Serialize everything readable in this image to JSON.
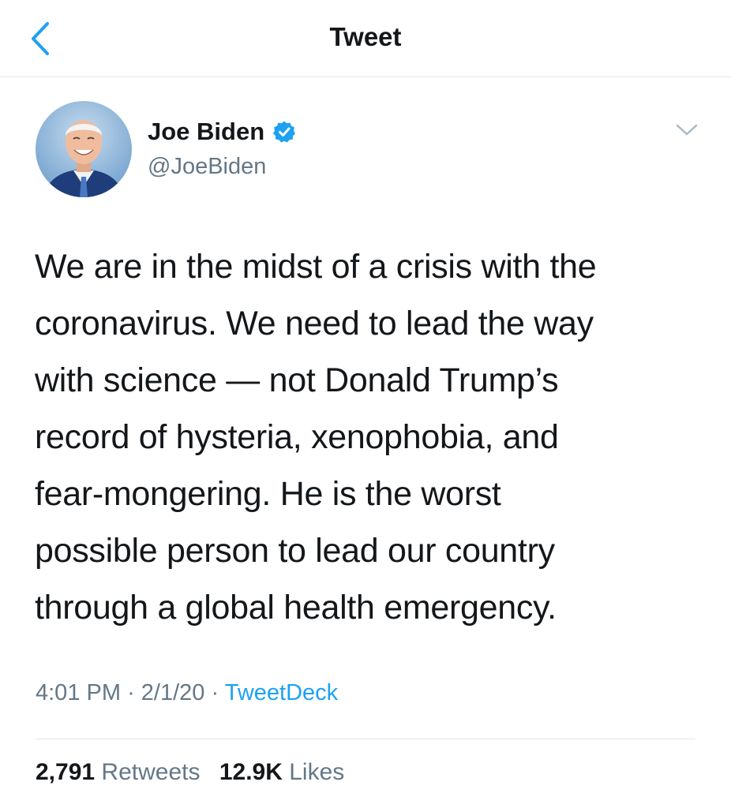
{
  "header": {
    "title": "Tweet",
    "back_icon": "chevron-left-icon"
  },
  "author": {
    "name": "Joe Biden",
    "handle": "@JoeBiden",
    "verified": true,
    "verified_icon": "verified-badge-icon"
  },
  "tweet": {
    "lines": [
      "We are in the midst of a crisis with the",
      "coronavirus. We need to lead the way",
      "with science — not Donald Trump’s",
      "record of hysteria, xenophobia, and",
      "fear-mongering. He is the worst",
      "possible person to lead our country",
      "through a global health emergency."
    ],
    "time": "4:01 PM",
    "date": "2/1/20",
    "separator": "·",
    "source": "TweetDeck"
  },
  "stats": {
    "retweets_count": "2,791",
    "retweets_label": "Retweets",
    "likes_count": "12.9K",
    "likes_label": "Likes"
  },
  "colors": {
    "accent": "#1da1f2",
    "text_primary": "#14171a",
    "text_secondary": "#657786",
    "divider": "#e1e8ed",
    "chevron": "#aab8c2"
  }
}
